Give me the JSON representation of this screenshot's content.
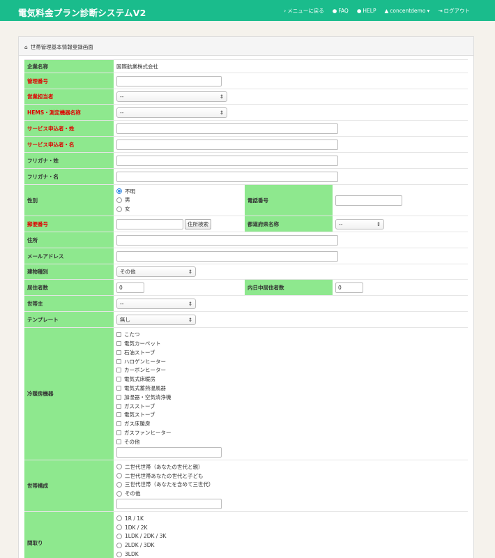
{
  "header": {
    "brand": "電気料金プラン診断システムV2",
    "menu_link": "メニューに戻る",
    "faq_link": "FAQ",
    "help_link": "HELP",
    "user": "concentdemo",
    "logout_link": "ログアウト"
  },
  "panel": {
    "title": "世帯管理基本情報登録画面"
  },
  "form": {
    "company_label": "企業名称",
    "company_value": "国際航業株式会社",
    "mgmt_no_label": "管理番号",
    "sales_label": "営業担当者",
    "sales_value": "--",
    "hems_label": "HEMS・測定機器名称",
    "hems_value": "--",
    "last_name_label": "サービス申込者・姓",
    "first_name_label": "サービス申込者・名",
    "kana_last_label": "フリガナ・姓",
    "kana_first_label": "フリガナ・名",
    "gender_label": "性別",
    "gender_options": [
      "不明",
      "男",
      "女"
    ],
    "phone_label": "電話番号",
    "zip_label": "郵便番号",
    "address_search_button": "住所検索",
    "prefecture_label": "都道府県名称",
    "prefecture_value": "--",
    "address_label": "住所",
    "email_label": "メールアドレス",
    "building_label": "建物種別",
    "building_value": "その他",
    "residents_label": "居住者数",
    "residents_value": "0",
    "daytime_label": "内日中居住者数",
    "daytime_value": "0",
    "householder_label": "世帯主",
    "householder_value": "--",
    "template_label": "テンプレート",
    "template_value": "無し",
    "heating_label": "冷暖房機器",
    "heating_options": [
      "こたつ",
      "電気カーペット",
      "石油ストーブ",
      "ハロゲンヒーター",
      "カーボンヒーター",
      "電気式床暖房",
      "電気式蓄熱温風器",
      "加湿器・空気清浄機",
      "ガスストーブ",
      "電気ストーブ",
      "ガス床暖房",
      "ガスファンヒーター",
      "その他"
    ],
    "household_label": "世帯構成",
    "household_options": [
      "二世代世帯（あなたの世代と親）",
      "二世代世帯あなたの世代と子ども",
      "三世代世帯（あなたを含めて三世代）",
      "その他"
    ],
    "layout_label": "間取り",
    "layout_options": [
      "1R / 1K",
      "1DK / 2K",
      "1LDK / 2DK / 3K",
      "2LDK / 3DK",
      "3LDK"
    ]
  }
}
